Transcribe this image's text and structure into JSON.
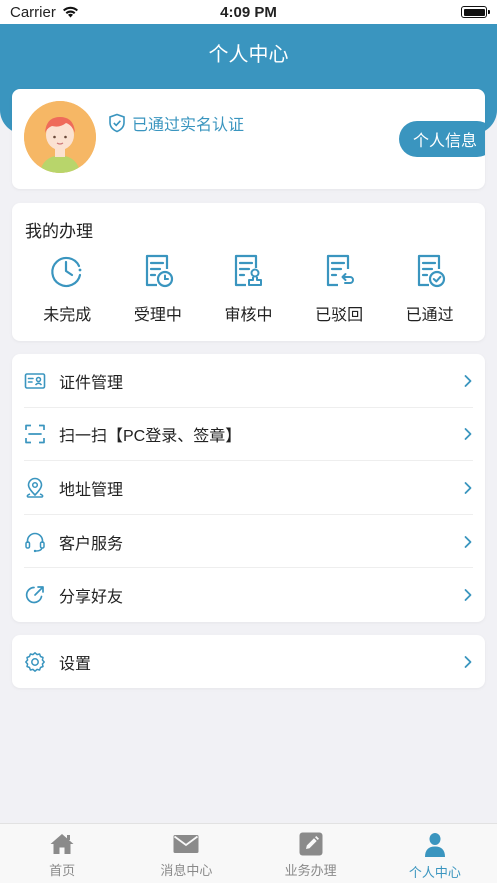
{
  "status_bar": {
    "carrier": "Carrier",
    "time": "4:09 PM"
  },
  "header": {
    "title": "个人中心"
  },
  "profile": {
    "verified_text": "已通过实名认证",
    "info_button": "个人信息"
  },
  "my_handle": {
    "title": "我的办理",
    "items": [
      {
        "label": "未完成",
        "icon": "clock-icon"
      },
      {
        "label": "受理中",
        "icon": "document-clock-icon"
      },
      {
        "label": "审核中",
        "icon": "document-stamp-icon"
      },
      {
        "label": "已驳回",
        "icon": "document-return-icon"
      },
      {
        "label": "已通过",
        "icon": "document-check-icon"
      }
    ]
  },
  "menu": [
    {
      "label": "证件管理",
      "icon": "id-card-icon"
    },
    {
      "label": "扫一扫【PC登录、签章】",
      "icon": "scan-icon"
    },
    {
      "label": "地址管理",
      "icon": "location-icon"
    },
    {
      "label": "客户服务",
      "icon": "headset-icon"
    },
    {
      "label": "分享好友",
      "icon": "share-icon"
    }
  ],
  "settings": {
    "label": "设置",
    "icon": "gear-icon"
  },
  "tabbar": [
    {
      "label": "首页",
      "icon": "home-icon",
      "active": false
    },
    {
      "label": "消息中心",
      "icon": "mail-icon",
      "active": false
    },
    {
      "label": "业务办理",
      "icon": "edit-icon",
      "active": false
    },
    {
      "label": "个人中心",
      "icon": "user-icon",
      "active": true
    }
  ],
  "colors": {
    "primary": "#3a95bf",
    "background": "#f1f1f5",
    "tab_inactive": "#8a8a8a"
  }
}
